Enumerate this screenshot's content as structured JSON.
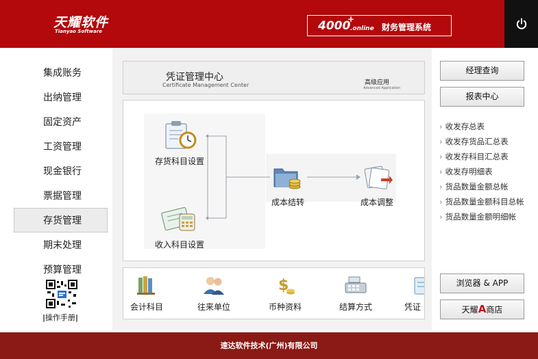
{
  "header": {
    "logo_cn": "天耀软件",
    "logo_en": "Tianyao Software",
    "product_number": "4000",
    "product_plus": "+",
    "product_online": ".online",
    "product_name": "财务管理系统",
    "power_icon": "power-icon",
    "colors": {
      "bar": "#b3080c",
      "power_bg": "#111111"
    }
  },
  "nav": {
    "items": [
      {
        "label": "集成账务"
      },
      {
        "label": "出纳管理"
      },
      {
        "label": "固定资产"
      },
      {
        "label": "工资管理"
      },
      {
        "label": "现金银行"
      },
      {
        "label": "票据管理"
      },
      {
        "label": "存货管理",
        "active": true
      },
      {
        "label": "期末处理"
      },
      {
        "label": "预算管理"
      }
    ],
    "qr_icon": "qr-code-icon",
    "manual_label": "操作手册"
  },
  "voucher_center": {
    "title": "凭证管理中心",
    "subtitle": "Certificate Management Center",
    "advanced_title": "高级应用",
    "advanced_sub": "Advanced Application"
  },
  "flow": {
    "inventory_subject": {
      "label": "存货科目设置",
      "icon": "clipboard-clock-icon"
    },
    "income_subject": {
      "label": "收入科目设置",
      "icon": "calculator-icon"
    },
    "cost_carryover": {
      "label": "成本结转",
      "icon": "folder-coins-icon"
    },
    "cost_adjust": {
      "label": "成本调整",
      "icon": "document-adjust-icon"
    }
  },
  "tools": [
    {
      "label": "会计科目",
      "icon": "books-icon"
    },
    {
      "label": "往来单位",
      "icon": "people-icon"
    },
    {
      "label": "币种资料",
      "icon": "dollar-coins-icon"
    },
    {
      "label": "结算方式",
      "icon": "cash-register-icon"
    },
    {
      "label": "凭证",
      "icon": "voucher-icon"
    }
  ],
  "right": {
    "manager_query": "经理查询",
    "report_center": "报表中心",
    "links": [
      "收发存总表",
      "收发存货品汇总表",
      "收发存科目汇总表",
      "收发存明细表",
      "货品数量金额总帐",
      "货品数量金额科目总帐",
      "货品数量金额明细帐"
    ],
    "browser_app": "浏览器 & APP",
    "store_prefix": "天耀",
    "store_a": "A",
    "store_suffix": "商店",
    "accent": "#c8101a"
  },
  "footer": {
    "text": "速达软件技术(广州)有限公司",
    "color": "#8b1a16"
  }
}
